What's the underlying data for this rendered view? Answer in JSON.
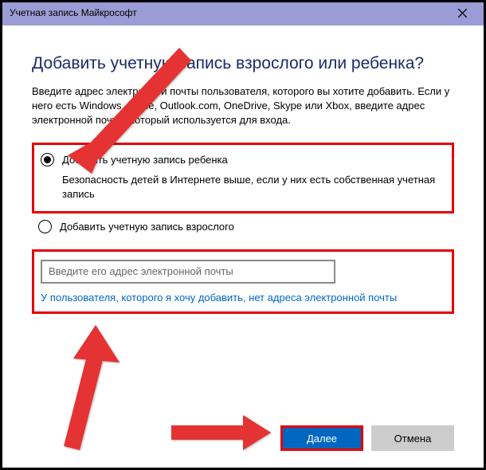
{
  "window": {
    "title": "Учетная запись Майкрософт"
  },
  "heading": "Добавить учетную запись взрослого или ребенка?",
  "description": "Введите адрес электронной почты пользователя, которого вы хотите добавить. Если у него есть Windows, Office, Outlook.com, OneDrive, Skype или Xbox, введите адрес электронной почты, который используется для входа.",
  "option_child": {
    "label": "Добавить учетную запись ребенка",
    "subtext": "Безопасность детей в Интернете выше, если у них есть собственная учетная запись"
  },
  "option_adult": {
    "label": "Добавить учетную запись взрослого"
  },
  "email": {
    "placeholder": "Введите его адрес электронной почты"
  },
  "no_email_link": "У пользователя, которого я хочу добавить, нет адреса электронной почты",
  "buttons": {
    "next": "Далее",
    "cancel": "Отмена"
  }
}
